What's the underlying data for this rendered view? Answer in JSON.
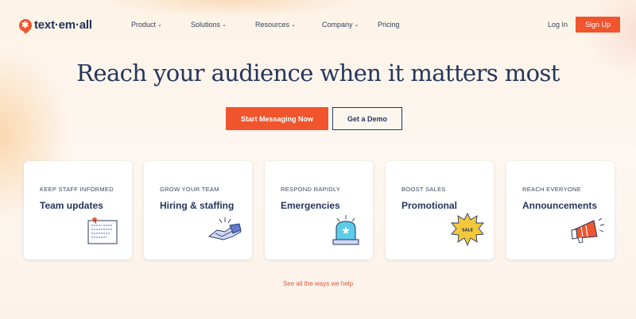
{
  "header": {
    "logo_text": "text·em·all",
    "nav": [
      {
        "label": "Product",
        "has_menu": true
      },
      {
        "label": "Solutions",
        "has_menu": true
      },
      {
        "label": "Resources",
        "has_menu": true
      },
      {
        "label": "Company",
        "has_menu": true
      },
      {
        "label": "Pricing",
        "has_menu": false
      }
    ],
    "chevron": "⌄",
    "login_label": "Log In",
    "signup_label": "Sign Up"
  },
  "hero": {
    "title": "Reach your audience when it matters most",
    "primary_cta": "Start Messaging Now",
    "secondary_cta": "Get a Demo"
  },
  "cards": [
    {
      "kicker": "KEEP STAFF INFORMED",
      "title": "Team updates",
      "icon": "note-icon"
    },
    {
      "kicker": "GROW YOUR TEAM",
      "title": "Hiring & staffing",
      "icon": "handshake-icon"
    },
    {
      "kicker": "RESPOND RAPIDLY",
      "title": "Emergencies",
      "icon": "siren-icon"
    },
    {
      "kicker": "BOOST SALES",
      "title": "Promotional",
      "icon": "sale-badge-icon"
    },
    {
      "kicker": "REACH EVERYONE",
      "title": "Announcements",
      "icon": "megaphone-icon"
    }
  ],
  "sale_badge_text": "SALE",
  "see_all_link": "See all the ways we help",
  "colors": {
    "accent": "#f0552e",
    "navy": "#25365d",
    "background": "#fdf5ec"
  }
}
